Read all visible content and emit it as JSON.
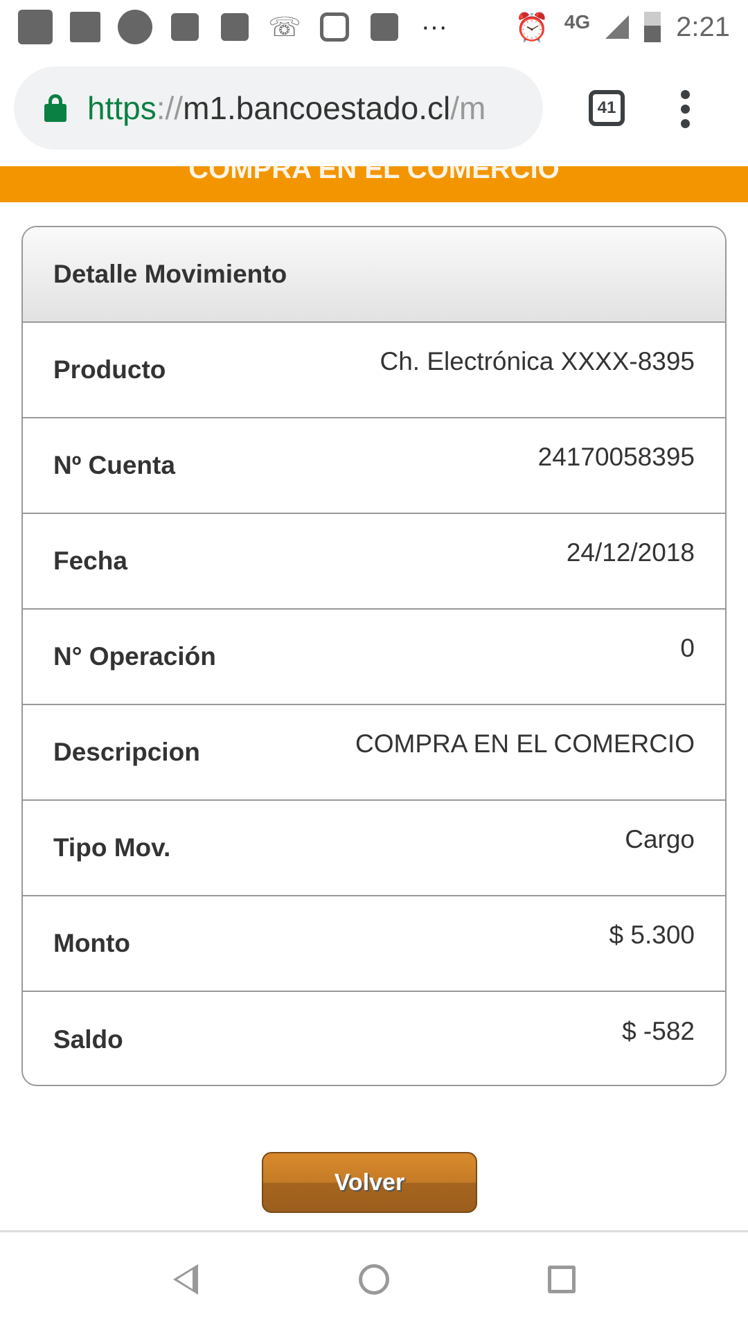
{
  "status_bar": {
    "time": "2:21",
    "network": "4G",
    "icons": [
      "bag-icon",
      "facebook-icon",
      "circle-icon",
      "notes-icon",
      "notes-icon",
      "missed-call-icon",
      "instagram-icon",
      "outlook-icon",
      "more-icon",
      "alarm-icon",
      "signal-icon",
      "battery-icon"
    ],
    "more": "···"
  },
  "browser": {
    "url_scheme": "https",
    "url_sep": "://",
    "url_host": "m1.bancoestado.cl",
    "url_path": "/m",
    "tab_count": "41"
  },
  "banner": {
    "text": "COMPRA EN EL COMERCIO",
    "color": "#f39500"
  },
  "card": {
    "title": "Detalle Movimiento",
    "rows": [
      {
        "label": "Producto",
        "value": "Ch. Electrónica XXXX-8395"
      },
      {
        "label": "Nº Cuenta",
        "value": "24170058395"
      },
      {
        "label": "Fecha",
        "value": "24/12/2018"
      },
      {
        "label": "N° Operación",
        "value": "0"
      },
      {
        "label": "Descripcion",
        "value": "COMPRA EN EL COMERCIO"
      },
      {
        "label": "Tipo Mov.",
        "value": "Cargo"
      },
      {
        "label": "Monto",
        "value": "$ 5.300"
      },
      {
        "label": "Saldo",
        "value": "$ -582"
      }
    ]
  },
  "actions": {
    "back_label": "Volver"
  }
}
